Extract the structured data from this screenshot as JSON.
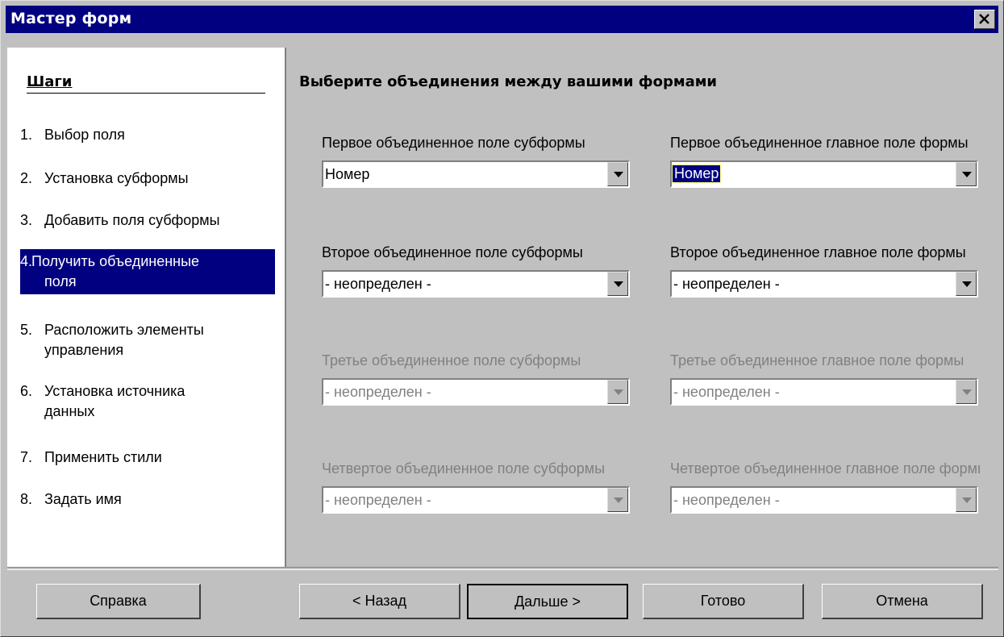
{
  "window": {
    "title": "Мастер форм",
    "close": "close-icon"
  },
  "steps": {
    "title": "Шаги",
    "items": [
      {
        "num": "1.",
        "label": "Выбор поля"
      },
      {
        "num": "2.",
        "label": "Установка субформы"
      },
      {
        "num": "3.",
        "label": "Добавить поля субформы"
      },
      {
        "num": "4.",
        "label": "Получить объединенные",
        "label2": "поля",
        "active": true
      },
      {
        "num": "5.",
        "label": "Расположить элементы",
        "label2": "управления"
      },
      {
        "num": "6.",
        "label": "Установка источника",
        "label2": "данных"
      },
      {
        "num": "7.",
        "label": "Применить стили"
      },
      {
        "num": "8.",
        "label": "Задать имя"
      }
    ]
  },
  "main": {
    "heading": "Выберите объединения между вашими формами",
    "fields": [
      {
        "sub_label": "Первое объединенное поле субформы",
        "sub_value": "Номер",
        "main_label": "Первое объединенное главное поле формы",
        "main_value": "Номер",
        "enabled": true
      },
      {
        "sub_label": "Второе объединенное поле субформы",
        "sub_value": "- неопределен -",
        "main_label": "Второе объединенное главное поле формы",
        "main_value": "- неопределен -",
        "enabled": true
      },
      {
        "sub_label": "Третье объединенное поле субформы",
        "sub_value": "- неопределен -",
        "main_label": "Третье объединенное главное поле формы",
        "main_value": "- неопределен -",
        "enabled": false
      },
      {
        "sub_label": "Четвертое объединенное поле субформы",
        "sub_value": "- неопределен -",
        "main_label": "Четвертое объединенное главное поле формы",
        "main_value": "- неопределен -",
        "enabled": false
      }
    ]
  },
  "buttons": {
    "help": "Справка",
    "back": "< Назад",
    "next": "Дальше >",
    "finish": "Готово",
    "cancel": "Отмена"
  }
}
